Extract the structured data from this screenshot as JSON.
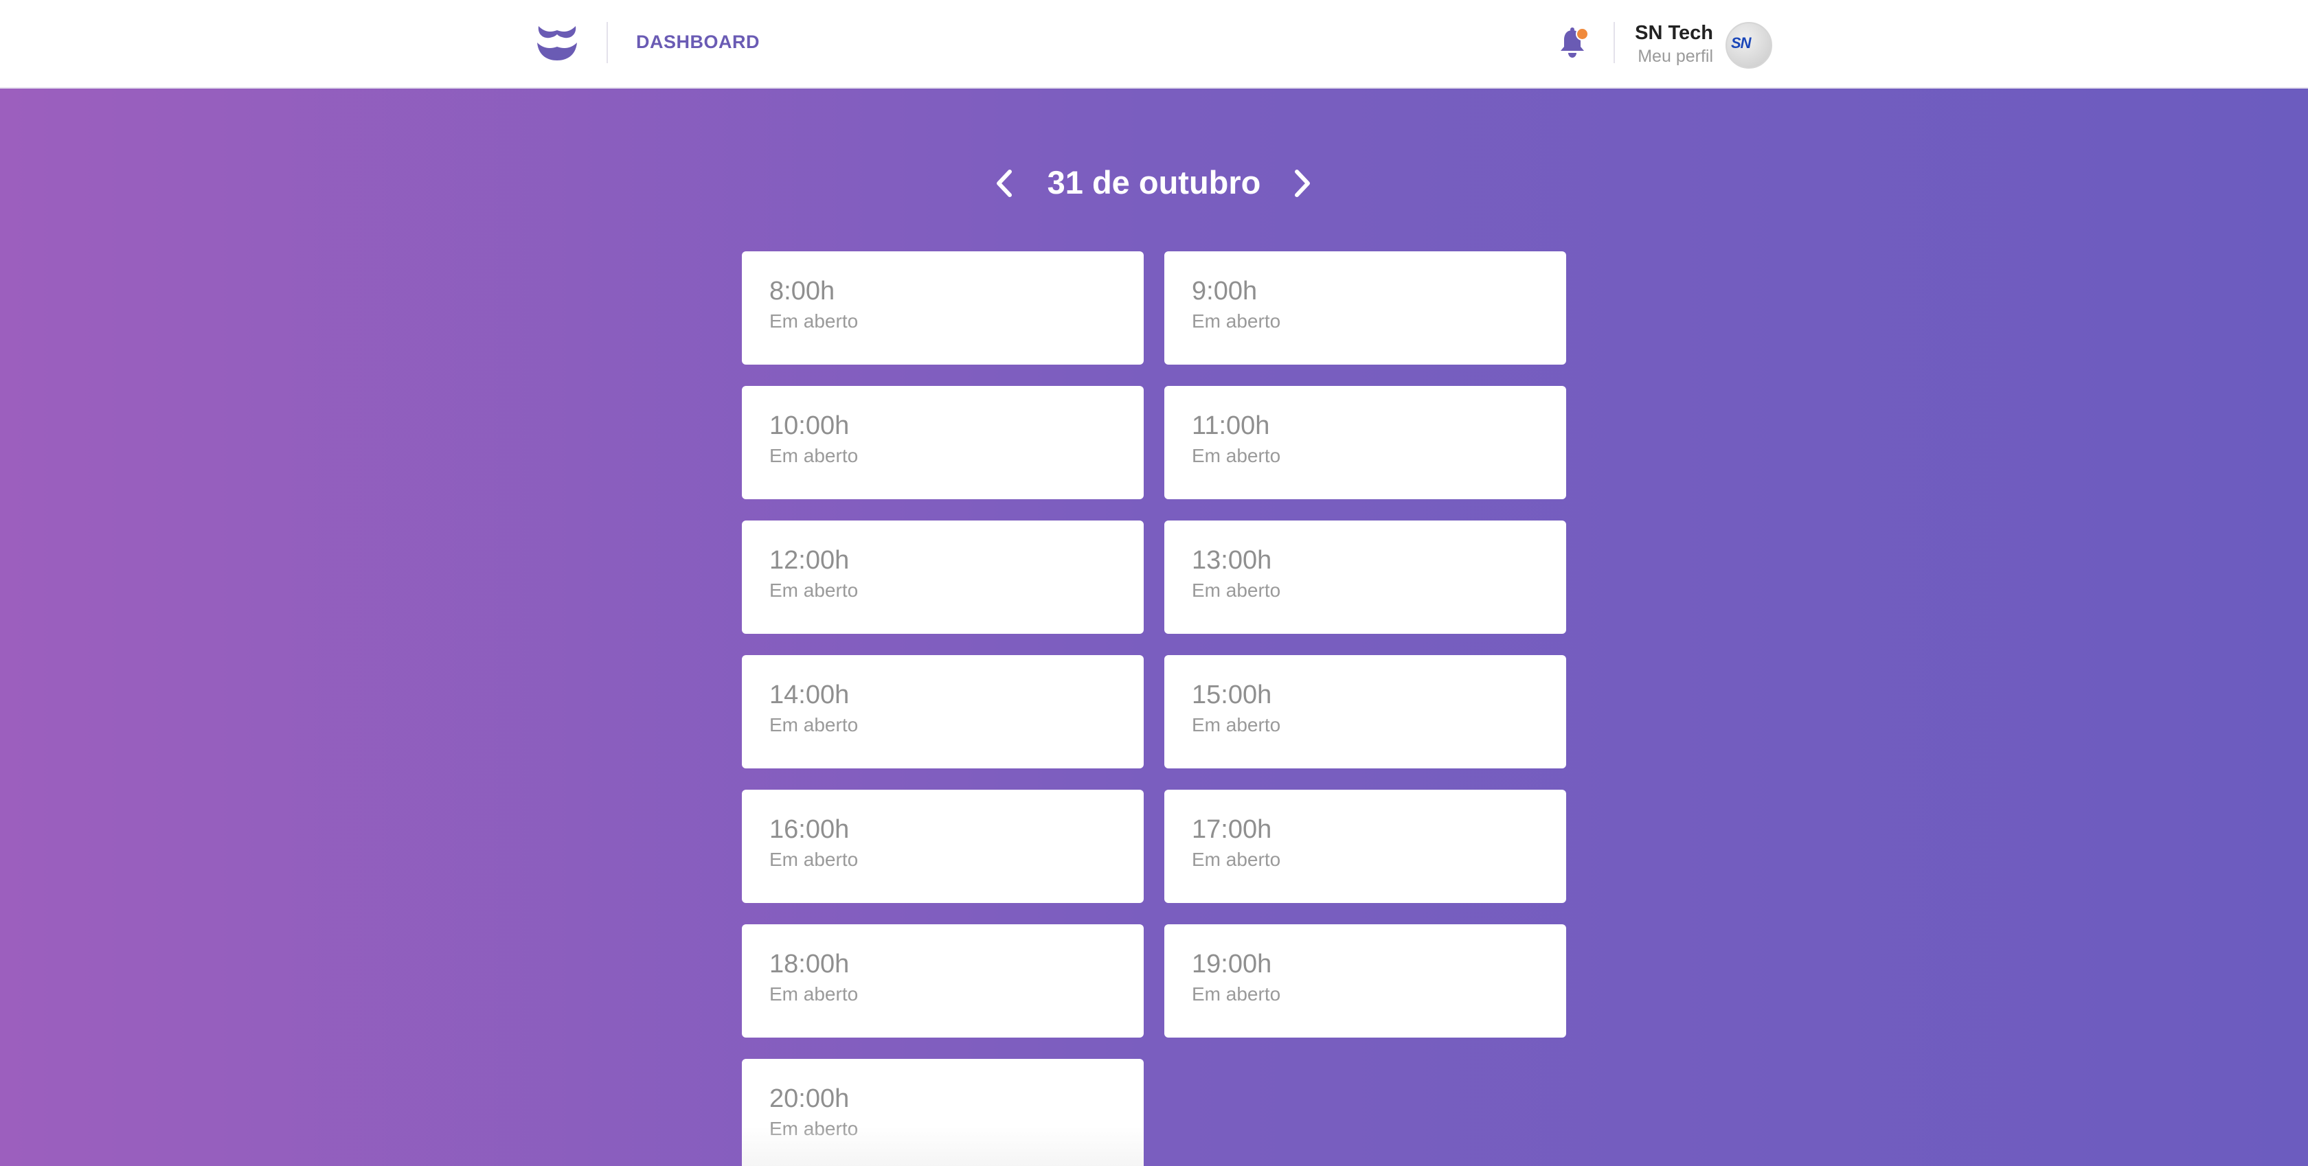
{
  "header": {
    "nav_label": "DASHBOARD",
    "notification_dot_color": "#f08a3c",
    "user": {
      "name": "SN Tech",
      "profile_link": "Meu perfil",
      "avatar_text": "SN"
    }
  },
  "date_nav": {
    "title": "31 de outubro",
    "prev_icon": "chevron-left-icon",
    "next_icon": "chevron-right-icon"
  },
  "slots": [
    {
      "time": "8:00h",
      "status": "Em aberto"
    },
    {
      "time": "9:00h",
      "status": "Em aberto"
    },
    {
      "time": "10:00h",
      "status": "Em aberto"
    },
    {
      "time": "11:00h",
      "status": "Em aberto"
    },
    {
      "time": "12:00h",
      "status": "Em aberto"
    },
    {
      "time": "13:00h",
      "status": "Em aberto"
    },
    {
      "time": "14:00h",
      "status": "Em aberto"
    },
    {
      "time": "15:00h",
      "status": "Em aberto"
    },
    {
      "time": "16:00h",
      "status": "Em aberto"
    },
    {
      "time": "17:00h",
      "status": "Em aberto"
    },
    {
      "time": "18:00h",
      "status": "Em aberto"
    },
    {
      "time": "19:00h",
      "status": "Em aberto"
    },
    {
      "time": "20:00h",
      "status": "Em aberto"
    }
  ],
  "colors": {
    "brand": "#6a5bb4",
    "background_start": "#9c5fbe",
    "background_end": "#6c5cbf"
  }
}
